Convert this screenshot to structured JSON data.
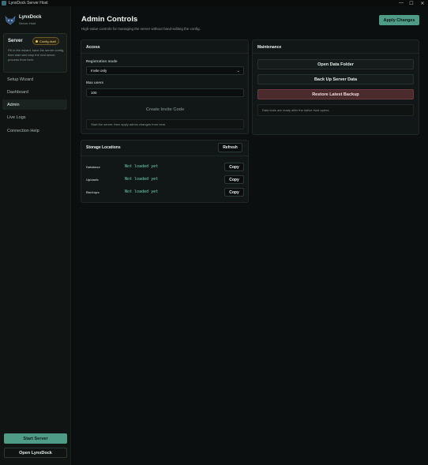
{
  "window": {
    "title": "LynxDock Server Host",
    "controls": {
      "minimize": "—",
      "maximize": "☐",
      "close": "✕"
    }
  },
  "brand": {
    "name": "LynxDock",
    "subtitle": "Server Host"
  },
  "server_card": {
    "label": "Server",
    "badge": "Config draft",
    "description": "Fill in the wizard, save the server config, then start and stop the real server process from here."
  },
  "nav": {
    "items": [
      {
        "label": "Setup Wizard"
      },
      {
        "label": "Dashboard"
      },
      {
        "label": "Admin"
      },
      {
        "label": "Live Logs"
      },
      {
        "label": "Connection Help"
      }
    ]
  },
  "sidebar_actions": {
    "start": "Start Server",
    "open": "Open LynxDock"
  },
  "page": {
    "title": "Admin Controls",
    "subtitle": "High-value controls for managing the server without hand-editing the config.",
    "apply": "Apply Changes"
  },
  "access": {
    "title": "Access",
    "registration_label": "Registration mode",
    "registration_value": "Invite only",
    "max_users_label": "Max users",
    "max_users_value": "100",
    "create_invite": "Create Invite Code",
    "hint": "Start the server, then apply admin changes from here."
  },
  "storage": {
    "title": "Storage Locations",
    "refresh": "Refresh",
    "rows": [
      {
        "key": "Database",
        "value": "Not loaded yet",
        "copy": "Copy"
      },
      {
        "key": "Uploads",
        "value": "Not loaded yet",
        "copy": "Copy"
      },
      {
        "key": "Backups",
        "value": "Not loaded yet",
        "copy": "Copy"
      }
    ]
  },
  "maintenance": {
    "title": "Maintenance",
    "open_folder": "Open Data Folder",
    "backup": "Back Up Server Data",
    "restore": "Restore Latest Backup",
    "hint": "Data tools are ready after the native host opens."
  },
  "colors": {
    "accent": "#4f9c86",
    "danger": "#4a2a2c",
    "badge": "#f0c84b",
    "mono_value": "#6fd0b0"
  }
}
